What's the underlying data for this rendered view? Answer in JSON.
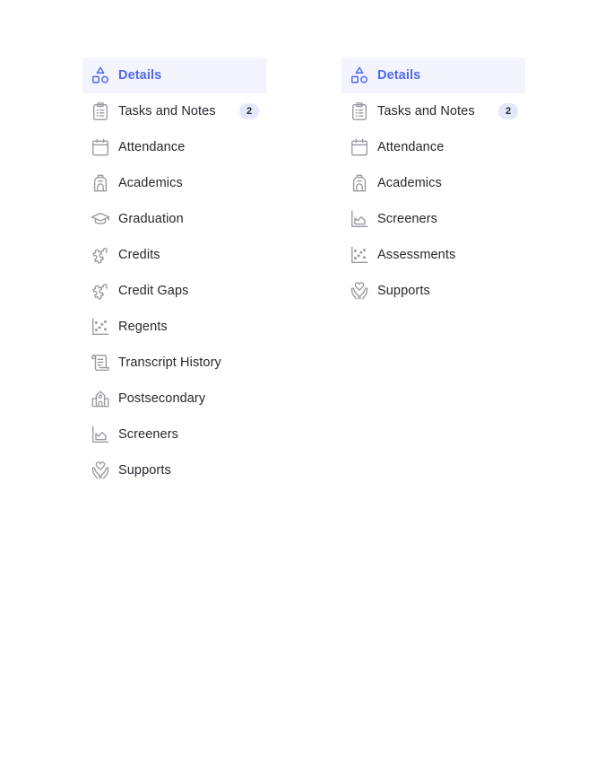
{
  "colors": {
    "accent": "#4f68f1",
    "active_bg": "#f3f4fe",
    "icon": "#9a9aa4",
    "badge_bg": "#e4e8fc",
    "text": "#27272f"
  },
  "left_nav": {
    "items": [
      {
        "label": "Details",
        "icon": "shapes-icon",
        "active": true
      },
      {
        "label": "Tasks and Notes",
        "icon": "clipboard-list-icon",
        "badge": "2"
      },
      {
        "label": "Attendance",
        "icon": "calendar-icon"
      },
      {
        "label": "Academics",
        "icon": "backpack-icon"
      },
      {
        "label": "Graduation",
        "icon": "graduation-cap-icon"
      },
      {
        "label": "Credits",
        "icon": "puzzle-icon"
      },
      {
        "label": "Credit Gaps",
        "icon": "puzzle-icon"
      },
      {
        "label": "Regents",
        "icon": "scatter-plot-icon"
      },
      {
        "label": "Transcript History",
        "icon": "scroll-icon"
      },
      {
        "label": "Postsecondary",
        "icon": "school-building-icon"
      },
      {
        "label": "Screeners",
        "icon": "area-chart-icon"
      },
      {
        "label": "Supports",
        "icon": "hands-heart-icon"
      }
    ]
  },
  "right_nav": {
    "items": [
      {
        "label": "Details",
        "icon": "shapes-icon",
        "active": true
      },
      {
        "label": "Tasks and Notes",
        "icon": "clipboard-list-icon",
        "badge": "2"
      },
      {
        "label": "Attendance",
        "icon": "calendar-icon"
      },
      {
        "label": "Academics",
        "icon": "backpack-icon"
      },
      {
        "label": "Screeners",
        "icon": "area-chart-icon"
      },
      {
        "label": "Assessments",
        "icon": "scatter-plot-icon"
      },
      {
        "label": "Supports",
        "icon": "hands-heart-icon"
      }
    ]
  }
}
